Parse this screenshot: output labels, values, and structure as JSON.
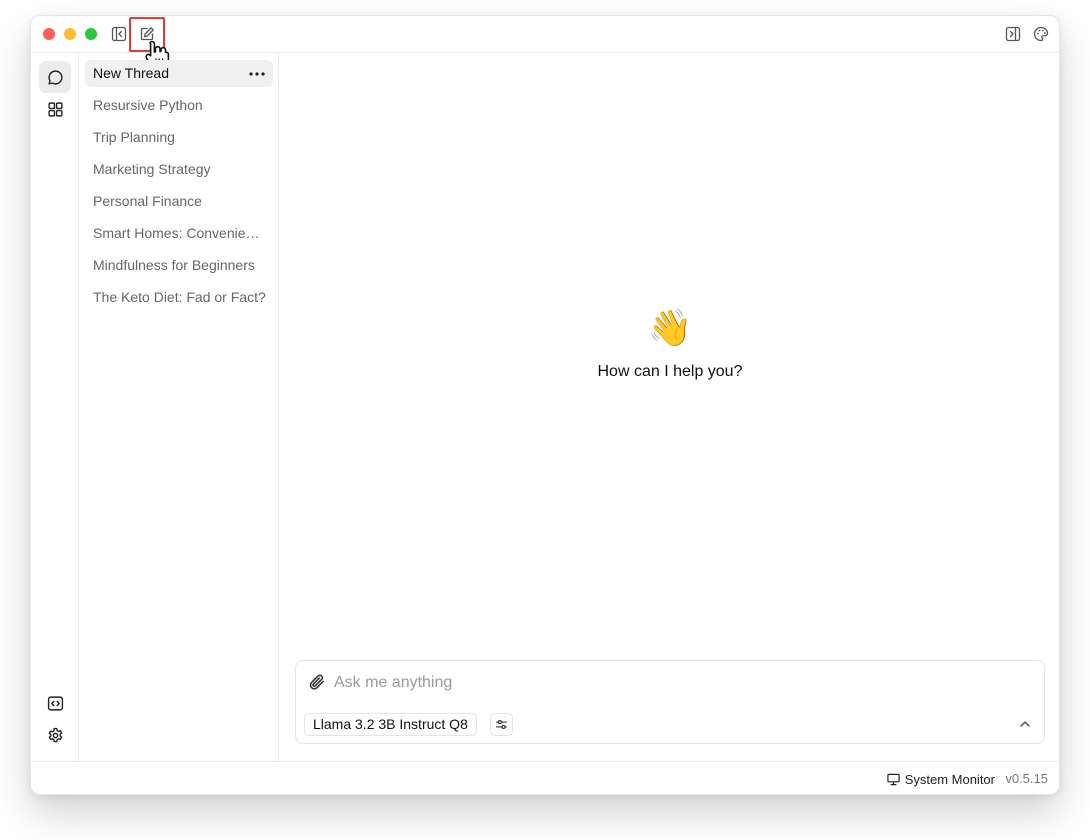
{
  "threads": {
    "items": [
      {
        "label": "New Thread",
        "active": true
      },
      {
        "label": "Resursive Python"
      },
      {
        "label": "Trip Planning"
      },
      {
        "label": "Marketing Strategy"
      },
      {
        "label": "Personal Finance"
      },
      {
        "label": "Smart Homes: Convenience or Compromise?"
      },
      {
        "label": "Mindfulness for Beginners"
      },
      {
        "label": "The Keto Diet: Fad or Fact?"
      }
    ]
  },
  "welcome": {
    "emoji": "👋",
    "text": "How can I help you?"
  },
  "composer": {
    "placeholder": "Ask me anything",
    "model": "Llama 3.2 3B Instruct Q8"
  },
  "statusbar": {
    "system_monitor": "System Monitor",
    "version": "v0.5.15"
  },
  "icons": {
    "titlebar": [
      "sidebar-toggle-icon",
      "new-thread-icon",
      "right-panel-icon",
      "palette-icon"
    ],
    "rail": [
      "chat-icon",
      "hub-grid-icon",
      "code-icon",
      "settings-gear-icon"
    ]
  },
  "colors": {
    "highlight": "#e53935",
    "traffic_red": "#ff5f57",
    "traffic_yellow": "#febc2e",
    "traffic_green": "#28c840"
  }
}
